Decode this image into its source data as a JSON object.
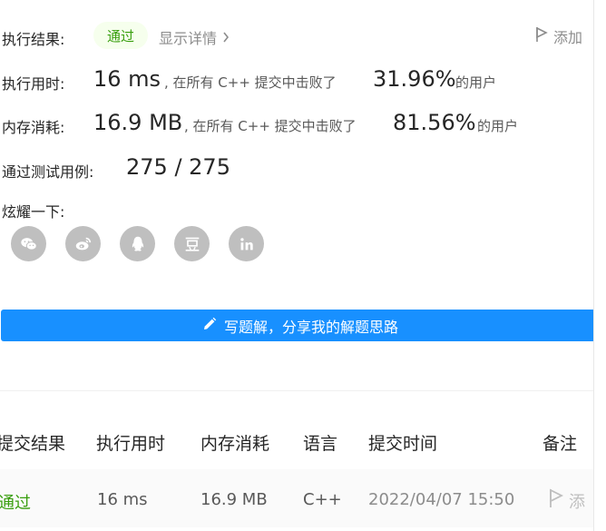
{
  "result": {
    "label": "执行结果:",
    "status": "通过",
    "details_link": "显示详情",
    "add_note": "添加"
  },
  "runtime": {
    "label": "执行用时:",
    "value": "16 ms",
    "text_before": ", 在所有 C++ 提交中击败了",
    "percent": "31.96%",
    "text_after": "的用户"
  },
  "memory": {
    "label": "内存消耗:",
    "value": "16.9 MB",
    "text_before": ", 在所有 C++ 提交中击败了",
    "percent": "81.56%",
    "text_after": "的用户"
  },
  "tests": {
    "label": "通过测试用例:",
    "value": "275 / 275"
  },
  "share": {
    "label": "炫耀一下:",
    "icons": [
      "wechat-icon",
      "weibo-icon",
      "qq-icon",
      "douban-icon",
      "linkedin-icon"
    ]
  },
  "cta": {
    "label": "写题解，分享我的解题思路"
  },
  "table": {
    "headers": [
      "提交结果",
      "执行用时",
      "内存消耗",
      "语言",
      "提交时间",
      "备注"
    ],
    "rows": [
      {
        "result": "通过",
        "runtime": "16 ms",
        "memory": "16.9 MB",
        "language": "C++",
        "time": "2022/04/07 15:50",
        "note": "添"
      }
    ]
  },
  "colors": {
    "accent": "#1890ff",
    "success": "#389e0d",
    "success_bg": "#f6ffed",
    "share_icon_bg": "#bfbfbf"
  }
}
